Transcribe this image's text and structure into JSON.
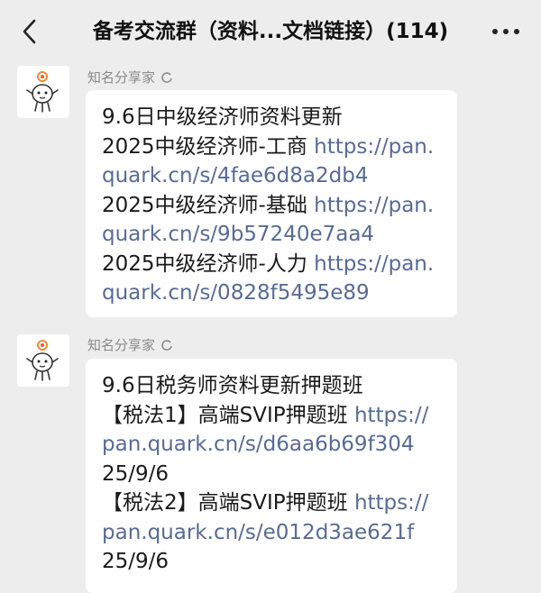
{
  "header": {
    "title": "备考交流群（资料...文档链接）(114)",
    "back_icon": "chevron-left-icon",
    "more_icon": "more-dots-icon"
  },
  "messages": [
    {
      "sender": "知名分享家",
      "avatar_icon": "cartoon-avatar",
      "lines": [
        {
          "text": "9.6日中级经济师资料更新",
          "link": ""
        },
        {
          "text": "2025中级经济师-工商 ",
          "link": "https://pan.quark.cn/s/4fae6d8a2db4"
        },
        {
          "text": "2025中级经济师-基础 ",
          "link": "https://pan.quark.cn/s/9b57240e7aa4"
        },
        {
          "text": "2025中级经济师-人力 ",
          "link": "https://pan.quark.cn/s/0828f5495e89"
        }
      ]
    },
    {
      "sender": "知名分享家",
      "avatar_icon": "cartoon-avatar",
      "lines": [
        {
          "text": "9.6日税务师资料更新押题班",
          "link": ""
        },
        {
          "text": "【税法1】高端SVIP押题班 ",
          "link": "https://pan.quark.cn/s/d6aa6b69f304"
        },
        {
          "text": "25/9/6",
          "link": ""
        },
        {
          "text": "【税法2】高端SVIP押题班 ",
          "link": "https://pan.quark.cn/s/e012d3ae621f"
        },
        {
          "text": "25/9/6",
          "link": ""
        }
      ]
    }
  ],
  "colors": {
    "background": "#ededed",
    "bubble": "#ffffff",
    "link": "#576b95",
    "sender_name": "#8a8a8a"
  }
}
